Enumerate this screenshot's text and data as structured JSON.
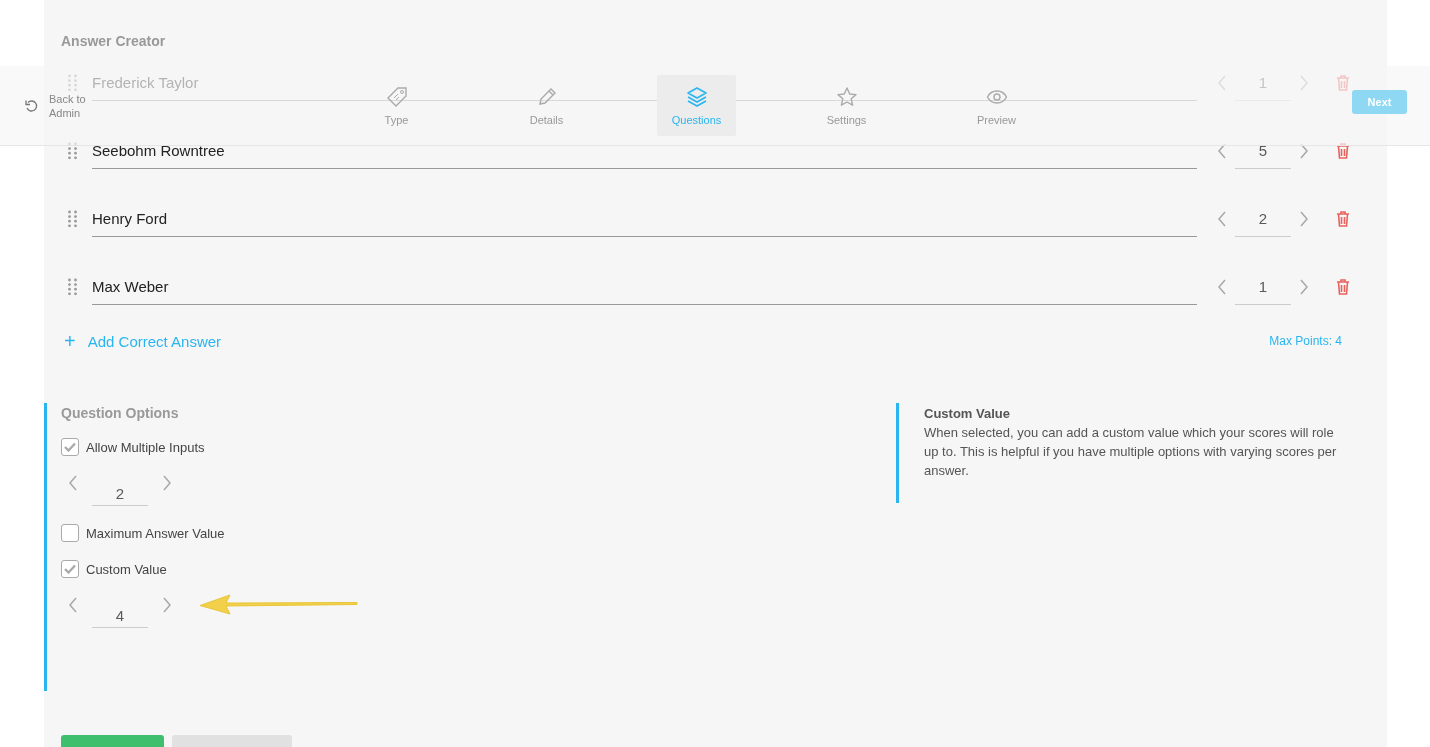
{
  "page": {
    "title": "Answer Creator"
  },
  "nav": {
    "back": "Back to Admin",
    "tabs": [
      {
        "label": "Type",
        "selected": false
      },
      {
        "label": "Details",
        "selected": false
      },
      {
        "label": "Questions",
        "selected": true
      },
      {
        "label": "Settings",
        "selected": false
      },
      {
        "label": "Preview",
        "selected": false
      }
    ],
    "next": "Next"
  },
  "answers": [
    {
      "text": "Frederick Taylor",
      "value": "1"
    },
    {
      "text": "Seebohm Rowntree",
      "value": "5"
    },
    {
      "text": "Henry Ford",
      "value": "2"
    },
    {
      "text": "Max Weber",
      "value": "1"
    }
  ],
  "add_answer": {
    "icon": "+",
    "label": "Add Correct Answer"
  },
  "max_points": "Max Points: 4",
  "question_options": {
    "title": "Question Options",
    "options": [
      {
        "label": "Allow Multiple Inputs",
        "checked": true,
        "value": "2"
      },
      {
        "label": "Maximum Answer Value",
        "checked": false
      },
      {
        "label": "Custom Value",
        "checked": true,
        "value": "4"
      }
    ]
  },
  "help": {
    "title": "Custom Value",
    "text": "When selected, you can add a custom value which your scores will role up to. This is helpful if you have multiple options with varying scores per answer."
  },
  "buttons": [
    {
      "kind": "primary"
    },
    {
      "kind": "secondary"
    }
  ]
}
